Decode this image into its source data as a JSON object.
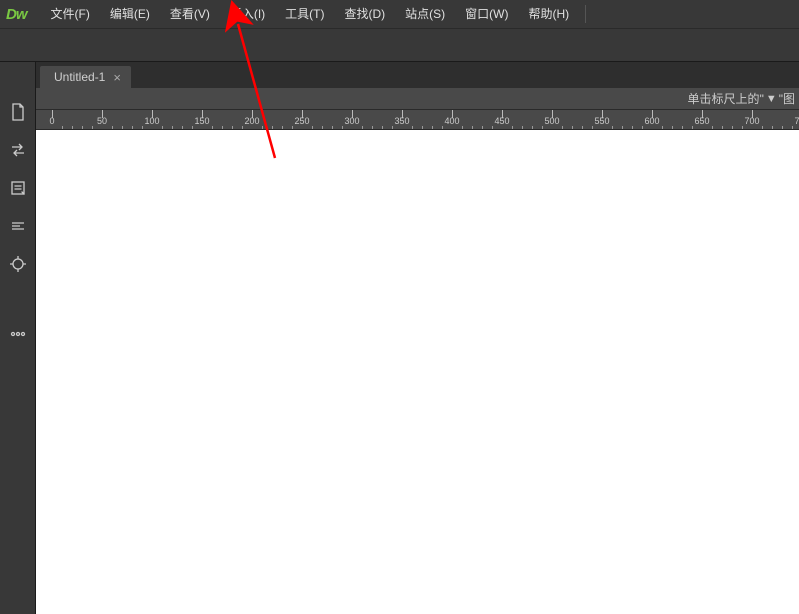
{
  "logo": "Dw",
  "menu": {
    "file": "文件(F)",
    "edit": "编辑(E)",
    "view": "查看(V)",
    "insert": "插入(I)",
    "tools": "工具(T)",
    "find": "查找(D)",
    "site": "站点(S)",
    "window": "窗口(W)",
    "help": "帮助(H)"
  },
  "tab": {
    "title": "Untitled-1",
    "close": "×"
  },
  "hint": {
    "prefix": "单击标尺上的",
    "icon": "▼",
    "suffix": "图"
  },
  "ruler": {
    "start": 0,
    "step": 50,
    "count": 16,
    "offset": 16
  }
}
